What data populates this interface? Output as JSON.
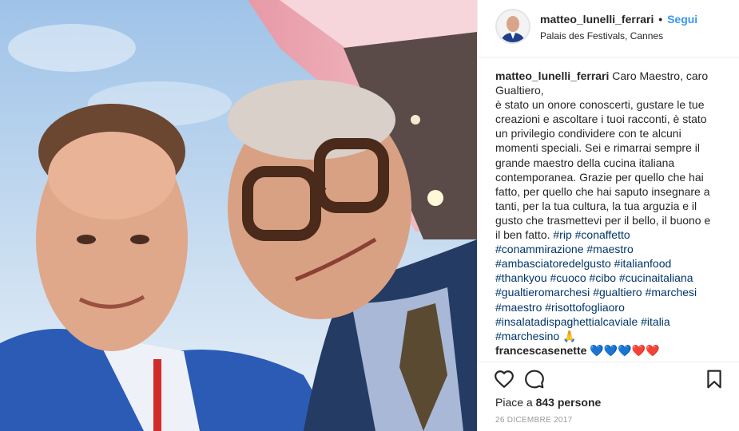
{
  "post": {
    "username": "matteo_lunelli_ferrari",
    "separator": "•",
    "follow_label": "Segui",
    "location": "Palais des Festivals, Cannes"
  },
  "caption": {
    "username": "matteo_lunelli_ferrari",
    "lines": [
      " Caro Maestro, caro",
      "Gualtiero,",
      "è stato un onore conoscerti, gustare le tue",
      "creazioni e ascoltare i tuoi racconti, è stato",
      "un privilegio condividere con te alcuni",
      "momenti speciali. Sei e rimarrai sempre il",
      "grande maestro della cucina italiana",
      "contemporanea. Grazie per quello che hai",
      "fatto, per quello che hai saputo insegnare a",
      "tanti, per la tua cultura, la tua arguzia e il",
      "gusto che trasmettevi per il bello, il buono e",
      "il ben fatto. "
    ],
    "hashtags": [
      [
        "#rip",
        "#conaffetto"
      ],
      [
        "#conammirazione",
        "#maestro"
      ],
      [
        "#ambasciatoredelgusto",
        "#italianfood"
      ],
      [
        "#thankyou",
        "#cuoco",
        "#cibo",
        "#cucinaitaliana"
      ],
      [
        "#gualtieromarchesi",
        "#gualtiero",
        "#marchesi"
      ],
      [
        "#maestro",
        "#risottofogliaoro"
      ],
      [
        "#insalatadispaghettialcaviale",
        "#italia"
      ],
      [
        "#marchesino"
      ]
    ],
    "end_emoji": "🙏"
  },
  "comment": {
    "username": "francescasenette",
    "text": " 💙💙💙❤️❤️"
  },
  "actions": {
    "like_icon": "heart-outline-icon",
    "comment_icon": "speech-bubble-icon",
    "save_icon": "bookmark-icon"
  },
  "likes": {
    "prefix": "Piace a ",
    "count": "843 persone"
  },
  "date": "26 DICEMBRE 2017",
  "colors": {
    "link": "#3897f0",
    "hashtag": "#003569",
    "text": "#262626",
    "muted": "#999999"
  }
}
